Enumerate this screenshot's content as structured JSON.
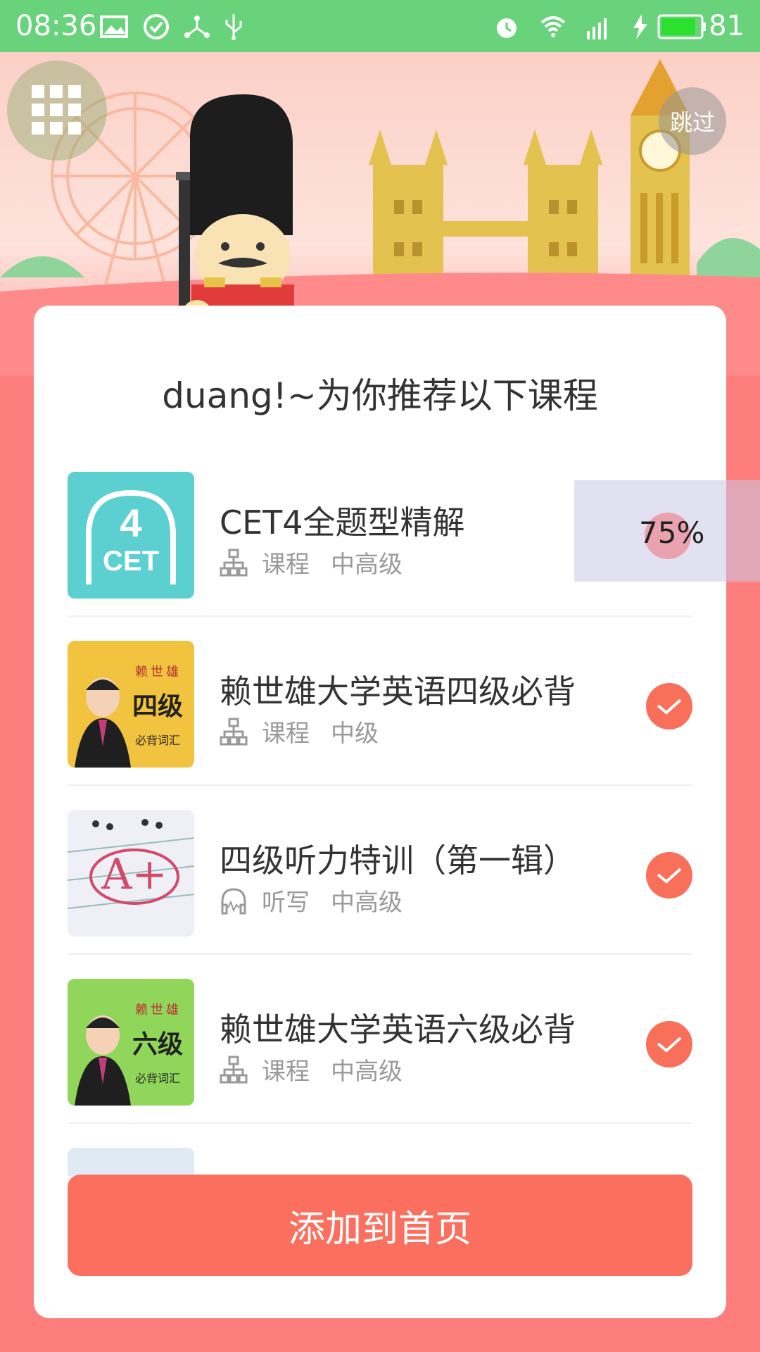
{
  "status_bar": {
    "time": "08:36",
    "battery_percent": "81",
    "icons": [
      "image-icon",
      "check-circle-icon",
      "share-icon",
      "usb-icon",
      "alarm-icon",
      "wifi-icon",
      "signal-4g-icon",
      "charging-icon",
      "battery-icon"
    ]
  },
  "header": {
    "skip_label": "跳过",
    "menu_icon": "grid-icon"
  },
  "card": {
    "title": "duang!~为你推荐以下课程",
    "courses": [
      {
        "name": "CET4全题型精解",
        "type": "课程",
        "level": "中高级",
        "type_icon": "hierarchy-icon",
        "thumb_icon": "cet4-badge-icon"
      },
      {
        "name": "赖世雄大学英语四级必背",
        "type": "课程",
        "level": "中级",
        "type_icon": "hierarchy-icon",
        "thumb": {
          "author": "赖世雄",
          "grade": "四级",
          "subtitle": "必背词汇"
        }
      },
      {
        "name": "四级听力特训（第一辑）",
        "type": "听写",
        "level": "中高级",
        "type_icon": "headphones-icon",
        "thumb_icon": "answer-sheet-icon"
      },
      {
        "name": "赖世雄大学英语六级必背",
        "type": "课程",
        "level": "中高级",
        "type_icon": "hierarchy-icon",
        "thumb": {
          "author": "赖世雄",
          "grade": "六级",
          "subtitle": "必背词汇"
        }
      }
    ],
    "add_button": "添加到首页"
  },
  "overlay": {
    "percent": "75%"
  },
  "colors": {
    "status_bar": "#68d37a",
    "accent": "#fb6f5e",
    "background": "#fe7e7e"
  }
}
